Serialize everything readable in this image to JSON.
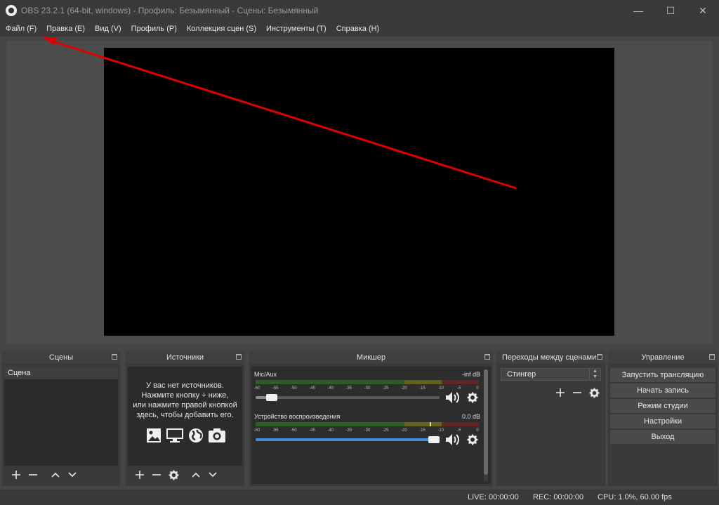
{
  "window": {
    "title": "OBS 23.2.1 (64-bit, windows) - Профиль: Безымянный - Сцены: Безымянный",
    "minimize": "—",
    "maximize": "☐",
    "close": "✕"
  },
  "menu": [
    "Файл (F)",
    "Правка (E)",
    "Вид (V)",
    "Профиль (P)",
    "Коллекция сцен (S)",
    "Инструменты (T)",
    "Справка (H)"
  ],
  "scenes": {
    "title": "Сцены",
    "items": [
      "Сцена"
    ]
  },
  "sources": {
    "title": "Источники",
    "empty_lines": [
      "У вас нет источников.",
      "Нажмите кнопку + ниже,",
      "или нажмите правой кнопкой",
      "здесь, чтобы добавить его."
    ],
    "icons": [
      "image-icon",
      "display-capture-icon",
      "browser-icon",
      "camera-icon"
    ]
  },
  "mixer": {
    "title": "Микшер",
    "scale": [
      "-60",
      "-55",
      "-50",
      "-45",
      "-40",
      "-35",
      "-30",
      "-25",
      "-20",
      "-15",
      "-10",
      "-5",
      "0"
    ],
    "tracks": [
      {
        "name": "Mic/Aux",
        "db": "-inf dB",
        "volume": 0.06,
        "meter_level": 0,
        "fader_color": "#8a8a8a"
      },
      {
        "name": "Устройство воспроизведения",
        "db": "0.0 dB",
        "volume": 1.0,
        "meter_level": 0.78,
        "fader_color": "#3d8ee0"
      }
    ]
  },
  "transitions": {
    "title": "Переходы между сценами",
    "selected": "Стингер"
  },
  "controls": {
    "title": "Управление",
    "buttons": [
      "Запустить трансляцию",
      "Начать запись",
      "Режим студии",
      "Настройки",
      "Выход"
    ]
  },
  "status": {
    "live": "LIVE: 00:00:00",
    "rec": "REC: 00:00:00",
    "cpu": "CPU: 1.0%, 60.00 fps"
  },
  "colors": {
    "annotation_arrow": "#e00000",
    "meter_green": "#3f8f2f",
    "meter_yellow": "#a09a2a",
    "meter_red": "#9a2e2e"
  }
}
